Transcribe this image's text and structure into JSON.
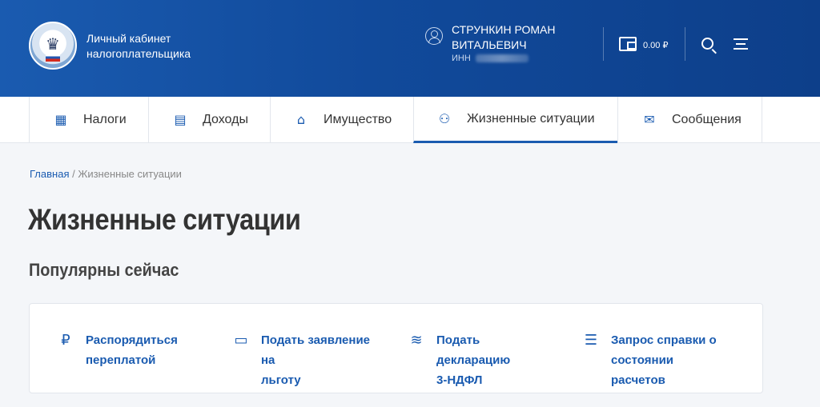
{
  "header": {
    "brand_line1": "Личный кабинет",
    "brand_line2": "налогоплательщика",
    "user_name_line1": "СТРУНКИН РОМАН",
    "user_name_line2": "ВИТАЛЬЕВИЧ",
    "inn_label": "ИНН",
    "balance": "0.00 ₽",
    "icons": [
      "logo-emblem",
      "user-icon",
      "wallet-icon",
      "search-icon",
      "menu-icon"
    ]
  },
  "tabs": [
    {
      "label": "Налоги",
      "icon": "taxes-icon",
      "glyph": "▦",
      "active": false
    },
    {
      "label": "Доходы",
      "icon": "income-icon",
      "glyph": "▤",
      "active": false
    },
    {
      "label": "Имущество",
      "icon": "property-icon",
      "glyph": "⌂",
      "active": false
    },
    {
      "label": "Жизненные ситуации",
      "icon": "life-situations-icon",
      "glyph": "⚇",
      "active": true
    },
    {
      "label": "Сообщения",
      "icon": "messages-icon",
      "glyph": "✉",
      "active": false
    }
  ],
  "breadcrumb": {
    "home": "Главная",
    "separator": " / ",
    "current": "Жизненные ситуации"
  },
  "page": {
    "title": "Жизненные ситуации",
    "subtitle": "Популярны сейчас"
  },
  "actions": [
    {
      "line1": "Распорядиться",
      "line2": "переплатой",
      "icon": "overpayment-icon",
      "glyph": "₽"
    },
    {
      "line1": "Подать заявление на",
      "line2": "льготу",
      "icon": "benefit-icon",
      "glyph": "▭"
    },
    {
      "line1": "Подать декларацию",
      "line2": "3-НДФЛ",
      "icon": "declaration-icon",
      "glyph": "≋"
    },
    {
      "line1": "Запрос справки о",
      "line2": "состоянии расчетов",
      "icon": "certificate-icon",
      "glyph": "☰"
    }
  ],
  "colors": {
    "accent": "#1a5bb0",
    "header_dark": "#0d3f8a",
    "background": "#f4f6f9"
  }
}
